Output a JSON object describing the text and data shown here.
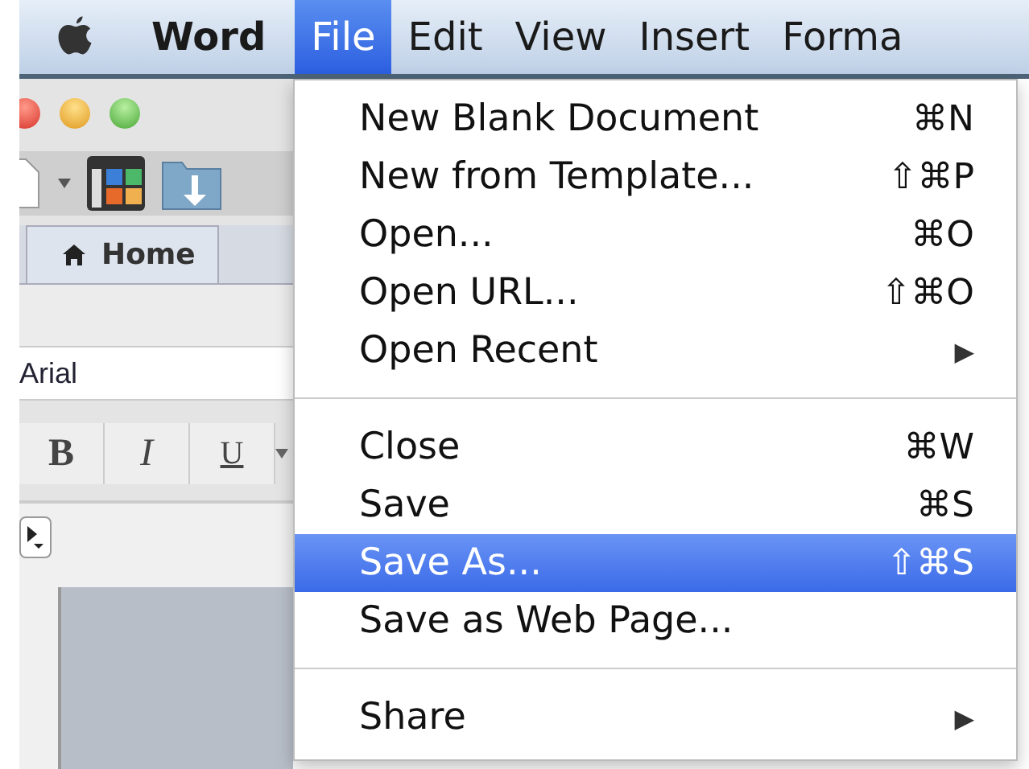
{
  "menu_bar": {
    "app_name": "Word",
    "items": [
      {
        "label": "File",
        "selected": true
      },
      {
        "label": "Edit",
        "selected": false
      },
      {
        "label": "View",
        "selected": false
      },
      {
        "label": "Insert",
        "selected": false
      },
      {
        "label": "Forma",
        "selected": false
      }
    ]
  },
  "window": {
    "tabs": [
      {
        "label": "Home",
        "selected": true
      }
    ],
    "font_field": {
      "value": "Arial"
    },
    "format_buttons": [
      {
        "label": "B",
        "kind": "bold"
      },
      {
        "label": "I",
        "kind": "italic"
      },
      {
        "label": "U",
        "kind": "underline"
      }
    ]
  },
  "file_menu": {
    "items": [
      {
        "kind": "item",
        "label": "New Blank Document",
        "shortcut": "⌘N",
        "selected": false
      },
      {
        "kind": "item",
        "label": "New from Template...",
        "shortcut": "⇧⌘P",
        "selected": false
      },
      {
        "kind": "item",
        "label": "Open...",
        "shortcut": "⌘O",
        "selected": false
      },
      {
        "kind": "item",
        "label": "Open URL...",
        "shortcut": "⇧⌘O",
        "selected": false
      },
      {
        "kind": "submenu",
        "label": "Open Recent",
        "arrow": "▶",
        "selected": false
      },
      {
        "kind": "separator"
      },
      {
        "kind": "item",
        "label": "Close",
        "shortcut": "⌘W",
        "selected": false
      },
      {
        "kind": "item",
        "label": "Save",
        "shortcut": "⌘S",
        "selected": false
      },
      {
        "kind": "item",
        "label": "Save As...",
        "shortcut": "⇧⌘S",
        "selected": true
      },
      {
        "kind": "item",
        "label": "Save as Web Page...",
        "selected": false
      },
      {
        "kind": "separator"
      },
      {
        "kind": "submenu",
        "label": "Share",
        "arrow": "▶",
        "selected": false
      }
    ]
  }
}
